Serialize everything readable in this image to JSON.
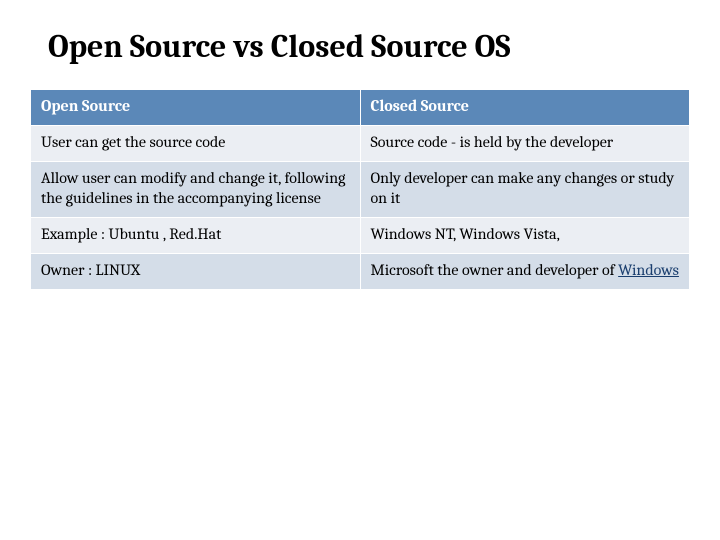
{
  "title": "Open Source vs Closed Source OS",
  "headers": {
    "left": "Open  Source",
    "right": "Closed Source"
  },
  "rows": {
    "r0": {
      "left": "User can get the source code",
      "right": "Source code -  is held by the developer"
    },
    "r1": {
      "left": "Allow user can modify and change it, following the guidelines in the accompanying license",
      "right": "Only developer can make any changes or study on it"
    },
    "r2": {
      "left": "Example  :  Ubuntu , Red.Hat",
      "right": "Windows NT, Windows Vista,"
    },
    "r3": {
      "left": "Owner  : LINUX",
      "rightPrefix": "Microsoft the owner and developer of ",
      "rightLink": "Windows"
    }
  }
}
